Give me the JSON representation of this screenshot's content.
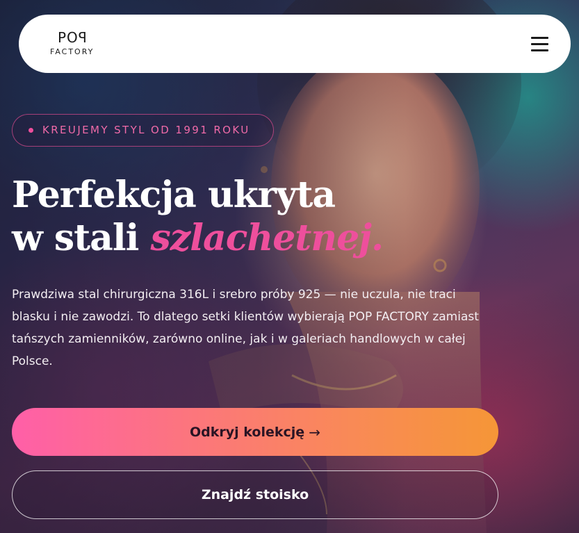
{
  "header": {
    "logo_top": "POꟼ",
    "logo_bottom": "FACTORY",
    "menu_icon": "hamburger-icon"
  },
  "hero": {
    "badge": "KREUJEMY STYL OD 1991 ROKU",
    "headline_line1": "Perfekcja ukryta",
    "headline_line2_plain": "w stali ",
    "headline_line2_accent": "szlachetnej.",
    "description": "Prawdziwa stal chirurgiczna 316L i srebro próby 925 — nie uczula, nie traci blasku i nie zawodzi. To dlatego setki klientów wybierają POP FACTORY zamiast tańszych zamienników, zarówno online, jak i w galeriach handlowych w całej Polsce.",
    "primary_button": "Odkryj kolekcję",
    "primary_button_arrow": "→",
    "secondary_button": "Znajdź stoisko"
  },
  "colors": {
    "accent_pink": "#ee4f9c",
    "gradient_start": "#ff5fa8",
    "gradient_end": "#f59637",
    "header_bg": "#ffffff"
  }
}
